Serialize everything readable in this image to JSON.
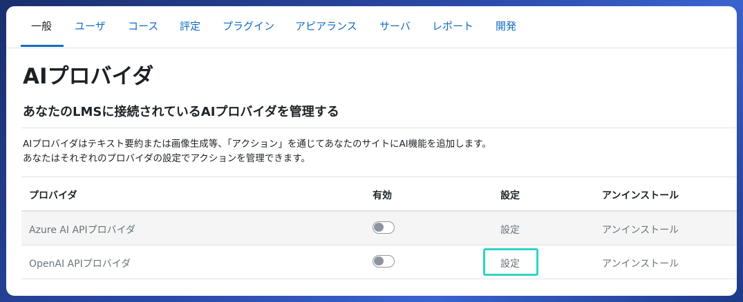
{
  "tabs": [
    {
      "label": "一般",
      "active": true
    },
    {
      "label": "ユーザ"
    },
    {
      "label": "コース"
    },
    {
      "label": "評定"
    },
    {
      "label": "プラグイン"
    },
    {
      "label": "アピアランス"
    },
    {
      "label": "サーバ"
    },
    {
      "label": "レポート"
    },
    {
      "label": "開発"
    }
  ],
  "page": {
    "title": "AIプロバイダ",
    "subtitle": "あなたのLMSに接続されているAIプロバイダを管理する",
    "description_line1": "AIプロバイダはテキスト要約または画像生成等、「アクション」を通じてあなたのサイトにAI機能を追加します。",
    "description_line2": "あなたはそれぞれのプロバイダの設定でアクションを管理できます。"
  },
  "table": {
    "headers": {
      "provider": "プロバイダ",
      "enabled": "有効",
      "settings": "設定",
      "uninstall": "アンインストール"
    },
    "rows": [
      {
        "provider": "Azure AI APIプロバイダ",
        "enabled": false,
        "settings": "設定",
        "uninstall": "アンインストール"
      },
      {
        "provider": "OpenAI APIプロバイダ",
        "enabled": false,
        "settings": "設定",
        "uninstall": "アンインストール",
        "highlighted": true
      }
    ]
  },
  "colors": {
    "link": "#0f6cbf",
    "highlight": "#2dd4c4",
    "toggle_off": "#8f959e"
  }
}
